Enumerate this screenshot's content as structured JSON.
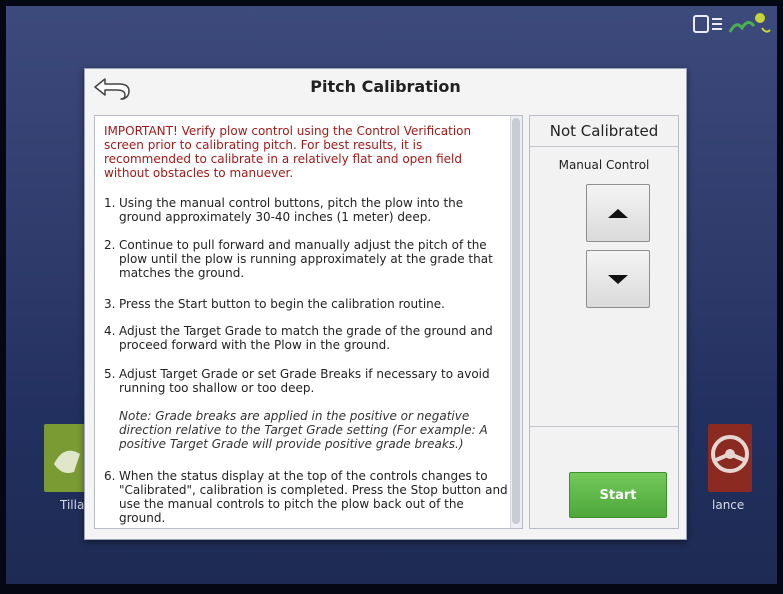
{
  "dialog": {
    "title": "Pitch Calibration",
    "back_icon": "back-arrow-icon"
  },
  "instructions": {
    "important": "IMPORTANT! Verify plow control using the Control Verification screen prior to calibrating pitch. For best results, it is recommended to calibrate in a relatively flat and open field without obstacles to manuever.",
    "steps": [
      {
        "num": "1.",
        "text": "Using the manual control buttons, pitch the plow into the ground approximately 30-40 inches (1 meter) deep."
      },
      {
        "num": "2.",
        "text": "Continue to pull forward and manually adjust the pitch of the plow until the plow is running approximately at the grade that matches the ground."
      },
      {
        "num": "3.",
        "text": "Press the Start button to begin the calibration routine."
      },
      {
        "num": "4.",
        "text": "Adjust the Target Grade to match the grade of the ground and proceed forward with the Plow in the ground."
      },
      {
        "num": "5.",
        "text": "Adjust Target Grade or set Grade Breaks if necessary to avoid running too shallow or too deep."
      },
      {
        "num": "6.",
        "text": "When the status display at the top of the controls changes to \"Calibrated\", calibration is completed. Press the Stop button and use the manual controls to pitch the plow back out of the ground."
      }
    ],
    "note": "Note: Grade breaks are applied in the positive or negative direction relative to the Target Grade setting (For example: A positive Target Grade will provide positive grade breaks.)"
  },
  "controls": {
    "status": "Not Calibrated",
    "manual_label": "Manual Control",
    "up_icon": "up-triangle-icon",
    "down_icon": "down-triangle-icon",
    "start_label": "Start"
  },
  "background": {
    "left_tile_label": "Tilla",
    "right_tile_label": "lance"
  },
  "colors": {
    "important_text": "#a11a1a",
    "start_button": "#5cb646"
  }
}
